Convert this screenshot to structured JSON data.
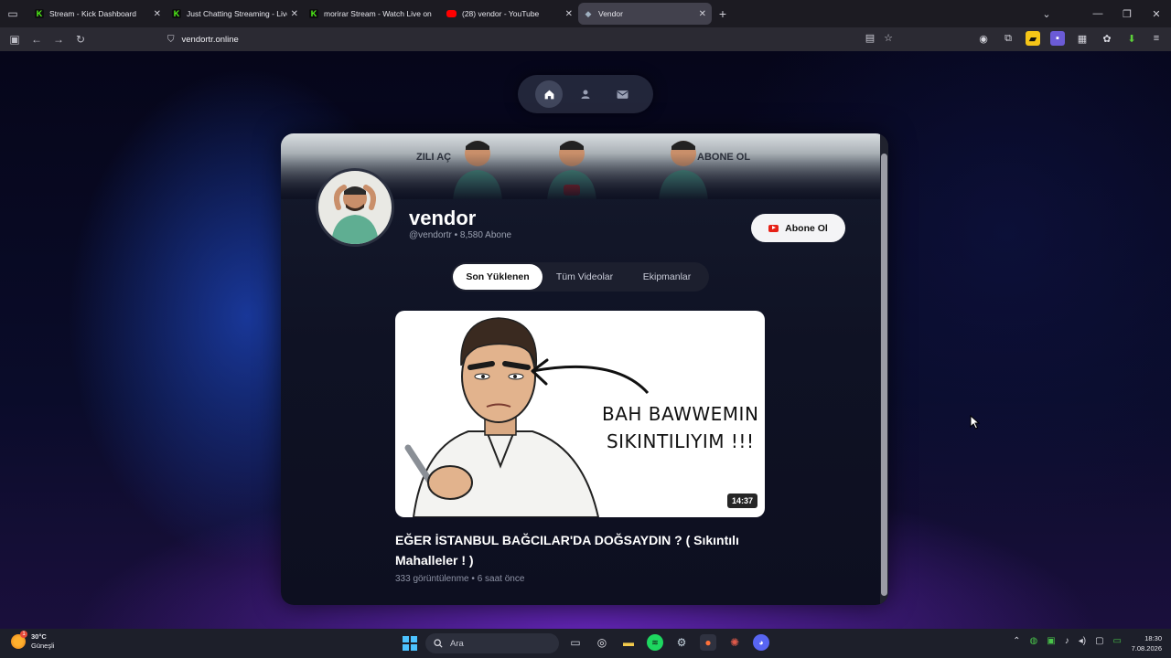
{
  "browser": {
    "tabs": [
      {
        "title": "Stream - Kick Dashboard",
        "favicon": "kick-icon",
        "active": false
      },
      {
        "title": "Just Chatting Streaming - Live S",
        "favicon": "kick-icon",
        "active": false
      },
      {
        "title": "morirar Stream - Watch Live on",
        "favicon": "kick-icon",
        "active": false
      },
      {
        "title": "(28) vendor - YouTube",
        "favicon": "youtube-icon",
        "active": false
      },
      {
        "title": "Vendor",
        "favicon": "vendor-icon",
        "active": true
      }
    ],
    "url": "vendortr.online",
    "colors": {
      "kick_green": "#53fc18",
      "youtube_red": "#ff0000"
    }
  },
  "site": {
    "nav": [
      "home-icon",
      "user-icon",
      "mail-icon"
    ],
    "banner": {
      "left_text": "ZILI AÇ",
      "right_text": "ABONE OL"
    },
    "channel": {
      "name": "vendor",
      "handle": "@vendortr",
      "subscribers": "8,580 Abone",
      "subscribe_label": "Abone Ol"
    },
    "tabs": [
      {
        "label": "Son Yüklenen",
        "active": true
      },
      {
        "label": "Tüm Videolar",
        "active": false
      },
      {
        "label": "Ekipmanlar",
        "active": false
      }
    ],
    "video": {
      "thumb_line1": "BAH BAWWEMIN",
      "thumb_line2": "SIKINTILIYIM !!!",
      "duration": "14:37",
      "title": "EĞER İSTANBUL BAĞCILAR'DA DOĞSAYDIN ? ( Sıkıntılı Mahalleler ! )",
      "views": "333 görüntülenme",
      "age": "6 saat önce"
    }
  },
  "taskbar": {
    "weather_temp": "30°C",
    "weather_desc": "Güneşli",
    "search_placeholder": "Ara",
    "time": "18:30",
    "date": "7.08.2026"
  }
}
